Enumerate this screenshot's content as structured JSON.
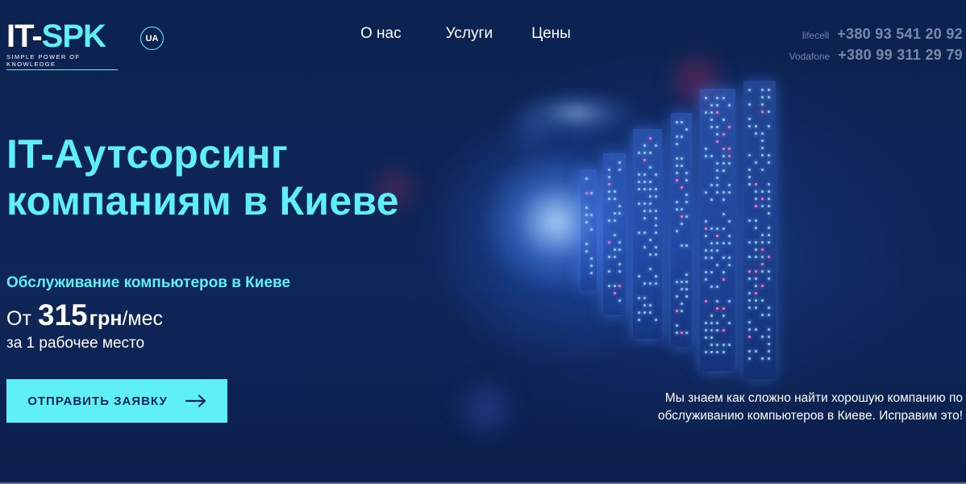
{
  "header": {
    "logo": {
      "main": "IT-",
      "accent": "SPK",
      "tagline": "SIMPLE POWER OF KNOWLEDGE"
    },
    "lang_badge": "UA",
    "nav": [
      {
        "label": "О нас"
      },
      {
        "label": "Услуги"
      },
      {
        "label": "Цены"
      }
    ],
    "phones": [
      {
        "operator": "lifecell",
        "number": "+380 93 541 20 92"
      },
      {
        "operator": "Vodafone",
        "number": "+380 99 311 29 79"
      }
    ]
  },
  "hero": {
    "title_line1": "IT-Аутсорсинг",
    "title_line2": "компаниям в Киеве",
    "subtitle": "Обслуживание компьютеров в Киеве",
    "price_prefix": "От",
    "price_value": "315",
    "price_currency": "грн",
    "price_period": "/мес",
    "price_note": "за 1 рабочее место",
    "cta_label": "ОТПРАВИТЬ ЗАЯВКУ",
    "description_line1": "Мы знаем как сложно найти хорошую компанию по",
    "description_line2": "обслуживанию компьютеров в Киеве. Исправим это!"
  },
  "colors": {
    "background": "#0d2456",
    "accent": "#5ff0f5",
    "text": "#ffffff"
  },
  "icons": {
    "cta_arrow": "arrow-right-icon"
  }
}
